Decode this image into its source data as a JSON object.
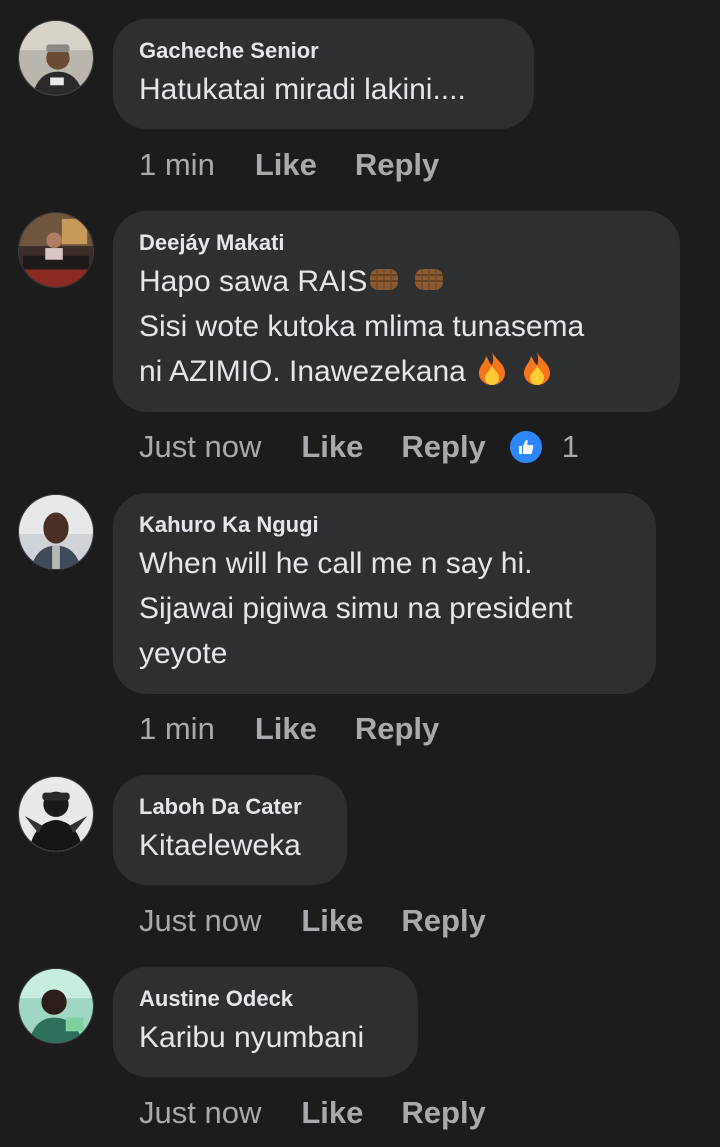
{
  "comments": [
    {
      "author": "Gacheche Senior",
      "text": "Hatukatai miradi lakini....",
      "time": "1 min",
      "like_label": "Like",
      "reply_label": "Reply"
    },
    {
      "author": "Deejáy Makati",
      "line1": "Hapo sawa RAIS",
      "line2": " Sisi wote kutoka mlima tunasema",
      "line3": "ni AZIMIO. Inawezekana ",
      "time": "Just now",
      "like_label": "Like",
      "reply_label": "Reply",
      "reaction_count": "1",
      "reaction_icon": "thumbs-up-icon",
      "emoji_1": "fist-bump-icon",
      "emoji_2": "fire-icon"
    },
    {
      "author": "Kahuro Ka Ngugi",
      "text": "When will he call me n say hi.\nSijawai pigiwa simu na president\nyeyote",
      "time": "1 min",
      "like_label": "Like",
      "reply_label": "Reply"
    },
    {
      "author": "Laboh Da Cater",
      "text": "Kitaeleweka",
      "time": "Just now",
      "like_label": "Like",
      "reply_label": "Reply"
    },
    {
      "author": "Austine Odeck",
      "text": "Karibu nyumbani",
      "time": "Just now",
      "like_label": "Like",
      "reply_label": "Reply"
    }
  ],
  "colors": {
    "background": "#1c1c1d",
    "bubble": "#2e2f31",
    "text": "#e4e6eb",
    "muted": "#a8aaad",
    "like_blue": "#2d88ff"
  }
}
